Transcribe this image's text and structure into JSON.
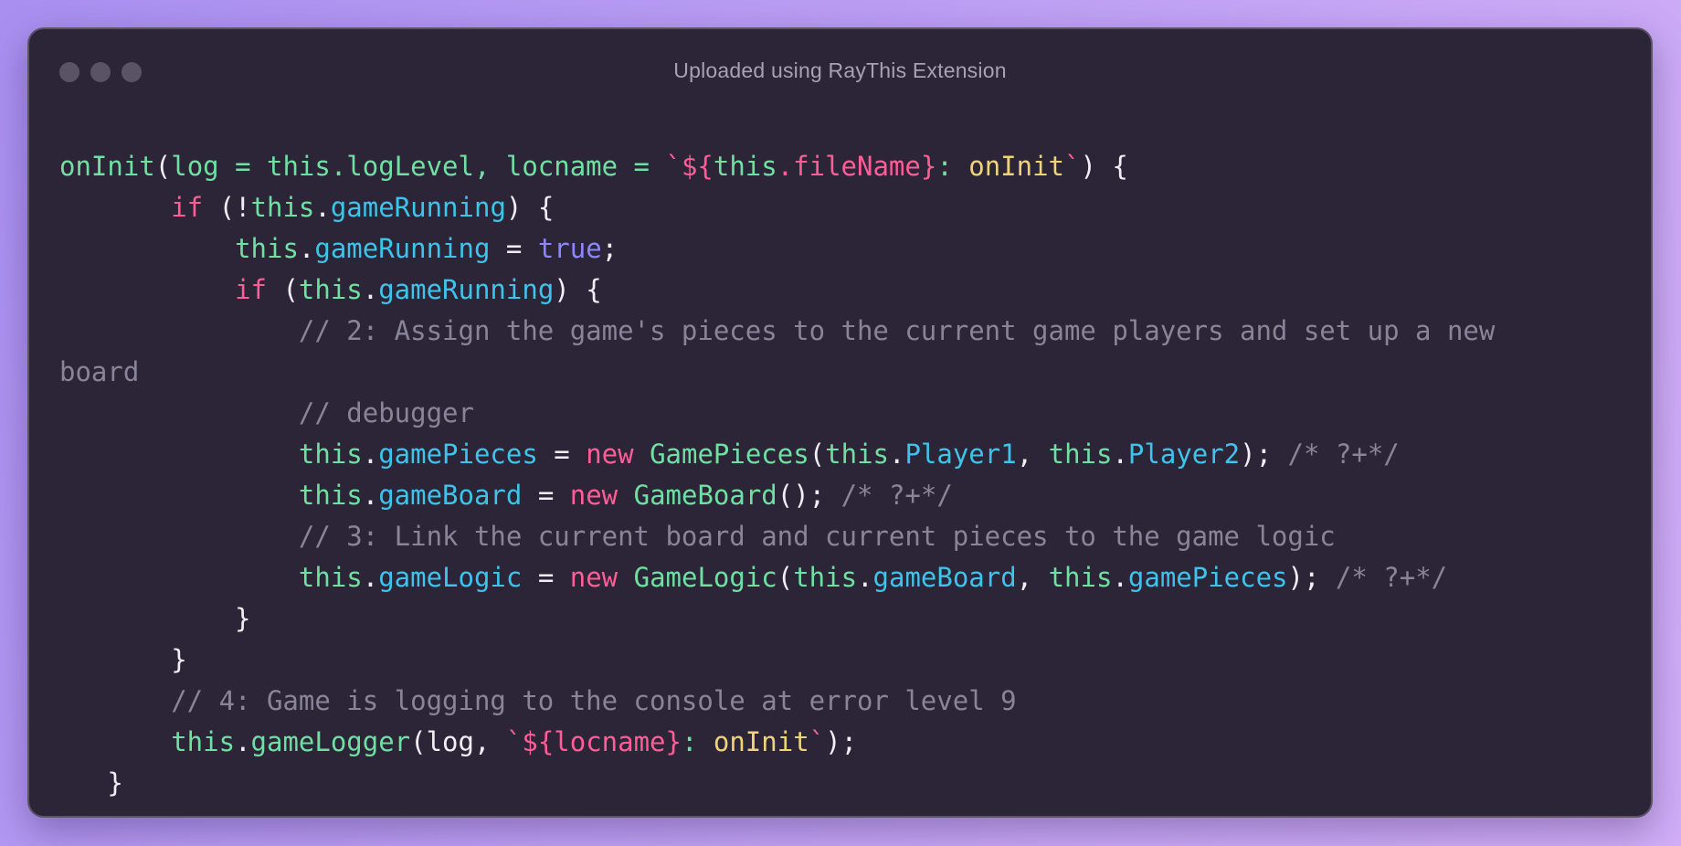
{
  "window": {
    "title": "Uploaded using RayThis Extension"
  },
  "code": {
    "lines": [
      [
        {
          "t": "onInit",
          "c": "fn"
        },
        {
          "t": "(",
          "c": "pun"
        },
        {
          "t": "log = this.logLevel, locname = ",
          "c": "fn"
        },
        {
          "t": "`${",
          "c": "kw"
        },
        {
          "t": "this",
          "c": "fn"
        },
        {
          "t": ".fileName}",
          "c": "kw"
        },
        {
          "t": ": ",
          "c": "fn"
        },
        {
          "t": "onInit",
          "c": "str"
        },
        {
          "t": "`",
          "c": "kw"
        },
        {
          "t": ") {",
          "c": "pun"
        }
      ],
      [
        {
          "t": "       ",
          "c": "pun"
        },
        {
          "t": "if",
          "c": "kw"
        },
        {
          "t": " (!",
          "c": "pun"
        },
        {
          "t": "this",
          "c": "fn"
        },
        {
          "t": ".",
          "c": "pun"
        },
        {
          "t": "gameRunning",
          "c": "prop"
        },
        {
          "t": ") {",
          "c": "pun"
        }
      ],
      [
        {
          "t": "           ",
          "c": "pun"
        },
        {
          "t": "this",
          "c": "fn"
        },
        {
          "t": ".",
          "c": "pun"
        },
        {
          "t": "gameRunning",
          "c": "prop"
        },
        {
          "t": " = ",
          "c": "pun"
        },
        {
          "t": "true",
          "c": "bool"
        },
        {
          "t": ";",
          "c": "pun"
        }
      ],
      [
        {
          "t": "           ",
          "c": "pun"
        },
        {
          "t": "if",
          "c": "kw"
        },
        {
          "t": " (",
          "c": "pun"
        },
        {
          "t": "this",
          "c": "fn"
        },
        {
          "t": ".",
          "c": "pun"
        },
        {
          "t": "gameRunning",
          "c": "prop"
        },
        {
          "t": ") {",
          "c": "pun"
        }
      ],
      [
        {
          "t": "               // 2: Assign the game's pieces to the current game players and set up a new",
          "c": "cmt"
        }
      ],
      [
        {
          "t": "board",
          "c": "cmt"
        }
      ],
      [
        {
          "t": "               // debugger",
          "c": "cmt"
        }
      ],
      [
        {
          "t": "               ",
          "c": "pun"
        },
        {
          "t": "this",
          "c": "fn"
        },
        {
          "t": ".",
          "c": "pun"
        },
        {
          "t": "gamePieces",
          "c": "prop"
        },
        {
          "t": " = ",
          "c": "pun"
        },
        {
          "t": "new",
          "c": "kw"
        },
        {
          "t": " ",
          "c": "pun"
        },
        {
          "t": "GamePieces",
          "c": "fn"
        },
        {
          "t": "(",
          "c": "pun"
        },
        {
          "t": "this",
          "c": "fn"
        },
        {
          "t": ".",
          "c": "pun"
        },
        {
          "t": "Player1",
          "c": "prop"
        },
        {
          "t": ", ",
          "c": "pun"
        },
        {
          "t": "this",
          "c": "fn"
        },
        {
          "t": ".",
          "c": "pun"
        },
        {
          "t": "Player2",
          "c": "prop"
        },
        {
          "t": "); ",
          "c": "pun"
        },
        {
          "t": "/* ?+*/",
          "c": "cmt"
        }
      ],
      [
        {
          "t": "               ",
          "c": "pun"
        },
        {
          "t": "this",
          "c": "fn"
        },
        {
          "t": ".",
          "c": "pun"
        },
        {
          "t": "gameBoard",
          "c": "prop"
        },
        {
          "t": " = ",
          "c": "pun"
        },
        {
          "t": "new",
          "c": "kw"
        },
        {
          "t": " ",
          "c": "pun"
        },
        {
          "t": "GameBoard",
          "c": "fn"
        },
        {
          "t": "(); ",
          "c": "pun"
        },
        {
          "t": "/* ?+*/",
          "c": "cmt"
        }
      ],
      [
        {
          "t": "               // 3: Link the current board and current pieces to the game logic",
          "c": "cmt"
        }
      ],
      [
        {
          "t": "               ",
          "c": "pun"
        },
        {
          "t": "this",
          "c": "fn"
        },
        {
          "t": ".",
          "c": "pun"
        },
        {
          "t": "gameLogic",
          "c": "prop"
        },
        {
          "t": " = ",
          "c": "pun"
        },
        {
          "t": "new",
          "c": "kw"
        },
        {
          "t": " ",
          "c": "pun"
        },
        {
          "t": "GameLogic",
          "c": "fn"
        },
        {
          "t": "(",
          "c": "pun"
        },
        {
          "t": "this",
          "c": "fn"
        },
        {
          "t": ".",
          "c": "pun"
        },
        {
          "t": "gameBoard",
          "c": "prop"
        },
        {
          "t": ", ",
          "c": "pun"
        },
        {
          "t": "this",
          "c": "fn"
        },
        {
          "t": ".",
          "c": "pun"
        },
        {
          "t": "gamePieces",
          "c": "prop"
        },
        {
          "t": "); ",
          "c": "pun"
        },
        {
          "t": "/* ?+*/",
          "c": "cmt"
        }
      ],
      [
        {
          "t": "           }",
          "c": "pun"
        }
      ],
      [
        {
          "t": "       }",
          "c": "pun"
        }
      ],
      [
        {
          "t": "       // 4: Game is logging to the console at error level 9",
          "c": "cmt"
        }
      ],
      [
        {
          "t": "       ",
          "c": "pun"
        },
        {
          "t": "this",
          "c": "fn"
        },
        {
          "t": ".",
          "c": "pun"
        },
        {
          "t": "gameLogger",
          "c": "fn"
        },
        {
          "t": "(log, ",
          "c": "pun"
        },
        {
          "t": "`${locname}",
          "c": "kw"
        },
        {
          "t": ": ",
          "c": "fn"
        },
        {
          "t": "onInit",
          "c": "str"
        },
        {
          "t": "`",
          "c": "kw"
        },
        {
          "t": ");",
          "c": "pun"
        }
      ],
      [
        {
          "t": "   }",
          "c": "pun"
        }
      ]
    ]
  }
}
